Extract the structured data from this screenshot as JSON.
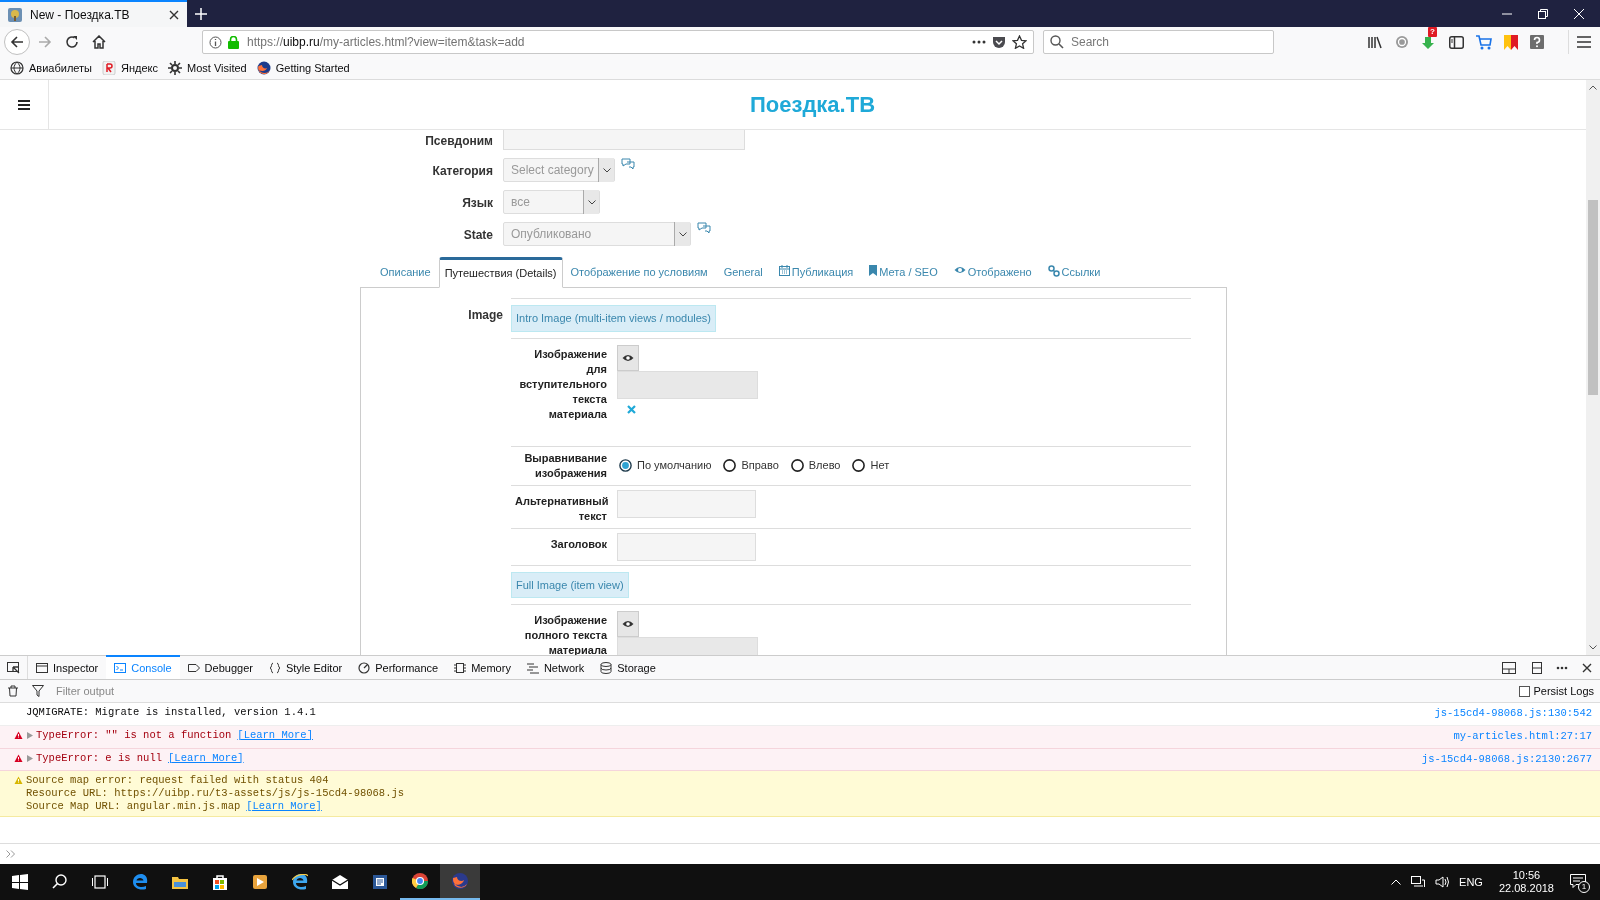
{
  "browser": {
    "tab_title": "New - Поездка.ТВ",
    "url_prefix": "https://",
    "url_host": "uibp.ru",
    "url_path": "/my-articles.html?view=item&task=add",
    "search_placeholder": "Search",
    "download_badge": "?",
    "bookmarks": [
      "Авиабилеты",
      "Яндекс",
      "Most Visited",
      "Getting Started"
    ]
  },
  "site": {
    "title": "Поездка.ТВ"
  },
  "form_fields": [
    {
      "label": "Псевдоним",
      "kind": "text"
    },
    {
      "label": "Категория",
      "kind": "select",
      "value": "Select category",
      "help": true
    },
    {
      "label": "Язык",
      "kind": "select",
      "value": "все",
      "help": false
    },
    {
      "label": "State",
      "kind": "select",
      "value": "Опубликовано",
      "help": true
    }
  ],
  "tabs": [
    {
      "label": "Описание",
      "selected": false
    },
    {
      "label": "Путешествия (Details)",
      "selected": true
    },
    {
      "label": "Отображение по условиям",
      "selected": false
    },
    {
      "label": "General",
      "selected": false
    },
    {
      "label": "Публикация",
      "selected": false
    },
    {
      "label": "Мета / SEO",
      "selected": false
    },
    {
      "label": "Отображено",
      "selected": false
    },
    {
      "label": "Ссылки",
      "selected": false
    }
  ],
  "image_section": {
    "label": "Image",
    "intro_heading": "Intro Image (multi-item views / modules)",
    "intro_image_label": "Изображение для вступительного текста материала",
    "align_label": "Выравнивание изображения",
    "align_options": [
      {
        "label": "По умолчанию",
        "selected": true
      },
      {
        "label": "Вправо",
        "selected": false
      },
      {
        "label": "Влево",
        "selected": false
      },
      {
        "label": "Нет",
        "selected": false
      }
    ],
    "alt_label": "Альтернативный текст",
    "caption_label": "Заголовок",
    "full_heading": "Full Image (item view)",
    "full_image_label": "Изображение полного текста материала"
  },
  "devtools": {
    "tools": [
      {
        "label": "Inspector",
        "selected": false
      },
      {
        "label": "Console",
        "selected": true
      },
      {
        "label": "Debugger",
        "selected": false
      },
      {
        "label": "Style Editor",
        "selected": false
      },
      {
        "label": "Performance",
        "selected": false
      },
      {
        "label": "Memory",
        "selected": false
      },
      {
        "label": "Network",
        "selected": false
      },
      {
        "label": "Storage",
        "selected": false
      }
    ],
    "filter_placeholder": "Filter output",
    "persist_logs": "Persist Logs",
    "persist_checked": false,
    "messages": [
      {
        "kind": "log",
        "lines": [
          "JQMIGRATE: Migrate is installed, version 1.4.1"
        ],
        "source": "js-15cd4-98068.js:130:542"
      },
      {
        "kind": "error",
        "lines": [
          "TypeError: \"\" is not a function"
        ],
        "link": "[Learn More]",
        "source": "my-articles.html:27:17"
      },
      {
        "kind": "error",
        "lines": [
          "TypeError: e is null"
        ],
        "link": "[Learn More]",
        "source": "js-15cd4-98068.js:2130:2677"
      },
      {
        "kind": "warning",
        "lines": [
          "Source map error: request failed with status 404",
          "Resource URL: https://uibp.ru/t3-assets/js/js-15cd4-98068.js",
          "Source Map URL: angular.min.js.map"
        ],
        "link": "[Learn More]"
      }
    ]
  },
  "taskbar": {
    "lang": "ENG",
    "time": "10:56",
    "date": "22.08.2018",
    "notification_count": "1"
  }
}
